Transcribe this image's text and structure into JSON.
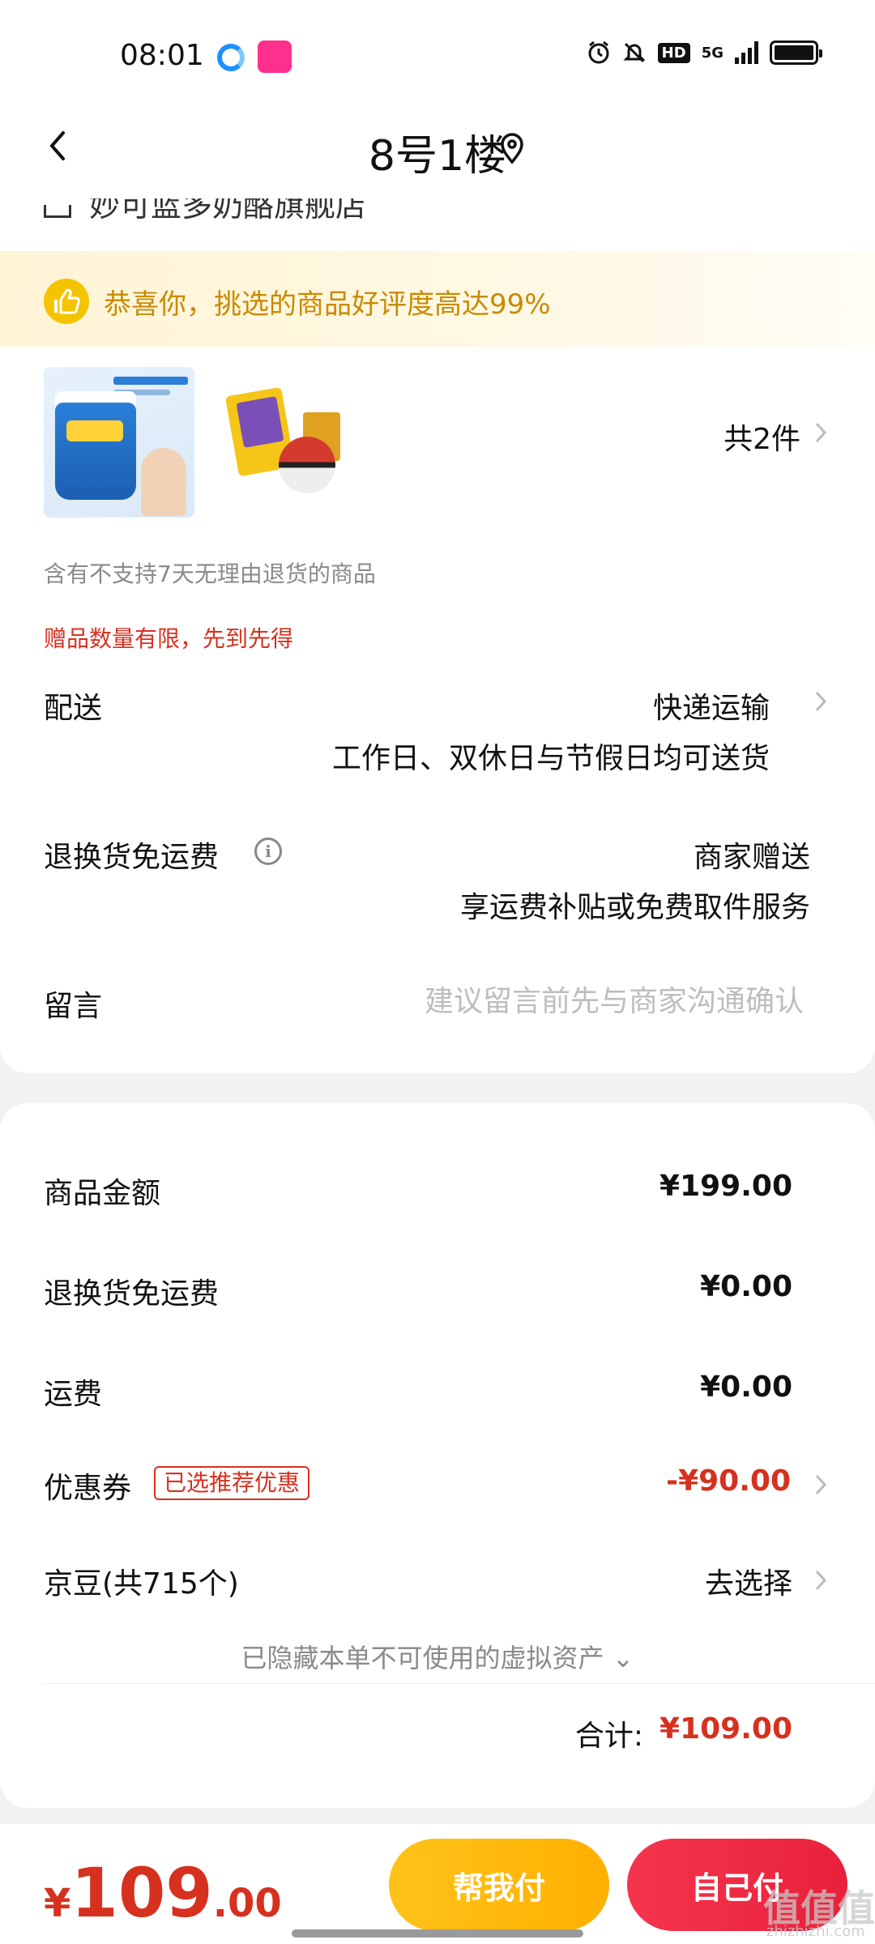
{
  "status_bar": {
    "time": "08:01",
    "app_icons": [
      "browser-icon",
      "vip-app-icon"
    ],
    "hd_label": "HD",
    "network_label": "5G",
    "battery_level": 1.0
  },
  "header": {
    "title": "8号1楼",
    "back_icon": "chevron-left-icon",
    "location_icon": "location-pin-icon"
  },
  "store": {
    "name": "妙可蓝多奶酪旗舰店"
  },
  "praise_banner": {
    "text": "恭喜你，挑选的商品好评度高达99%",
    "icon": "thumbs-up-icon"
  },
  "products": {
    "count_label": "共2件"
  },
  "notes": {
    "return_policy": "含有不支持7天无理由退货的商品",
    "gift_limit": "赠品数量有限，先到先得"
  },
  "shipping": {
    "label": "配送",
    "value": "快递运输",
    "sub": "工作日、双休日与节假日均可送货"
  },
  "return_shipping": {
    "label": "退换货免运费",
    "value": "商家赠送",
    "sub": "享运费补贴或免费取件服务"
  },
  "message": {
    "label": "留言",
    "placeholder": "建议留言前先与商家沟通确认"
  },
  "summary": {
    "rows": [
      {
        "label": "商品金额",
        "value": "¥199.00"
      },
      {
        "label": "退换货免运费",
        "value": "¥0.00"
      },
      {
        "label": "运费",
        "value": "¥0.00"
      }
    ],
    "coupon": {
      "label": "优惠券",
      "tag": "已选推荐优惠",
      "value": "-¥90.00"
    },
    "jingdou": {
      "label": "京豆(共715个)",
      "value": "去选择"
    },
    "hidden_assets": "已隐藏本单不可使用的虚拟资产 ⌄",
    "total_label": "合计:",
    "total_value": "¥109.00"
  },
  "bottom_bar": {
    "currency": "¥",
    "amount_int": "109",
    "amount_dec": ".00",
    "help_pay": "帮我付",
    "self_pay": "自己付"
  },
  "watermark": {
    "text": "值值值",
    "sub": "zhizhizhi.com"
  },
  "colors": {
    "accent_red": "#d6311f",
    "help_button": "#ffb000",
    "self_button": "#e8213a",
    "praise_text": "#c98a00"
  }
}
